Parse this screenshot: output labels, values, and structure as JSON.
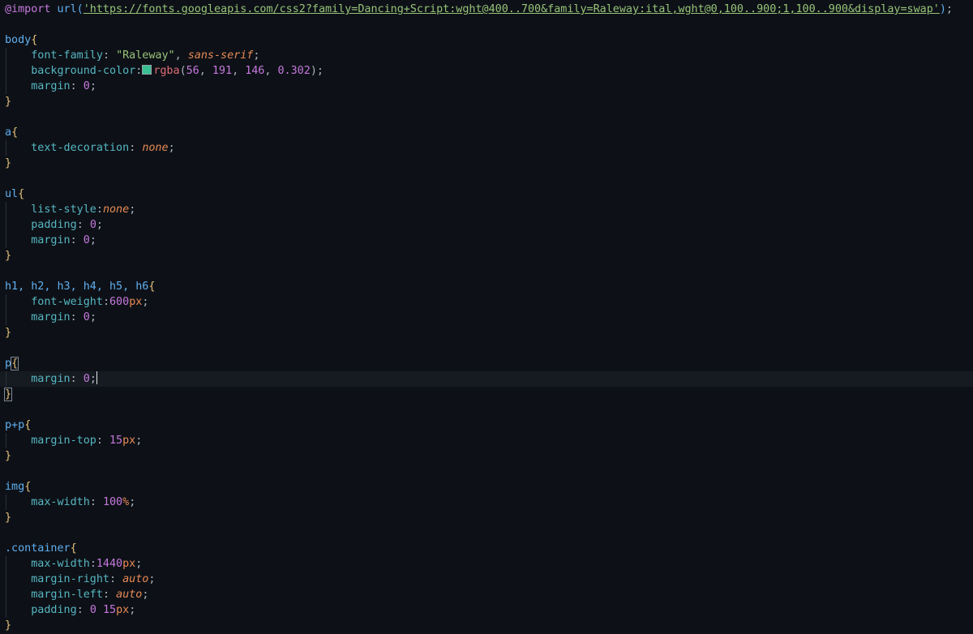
{
  "editor": {
    "language": "css",
    "cursor_line": 24,
    "swatch_color": "#38bf92",
    "lines": [
      {
        "tokens": [
          {
            "t": "@import",
            "c": "atrule"
          },
          {
            "t": " ",
            "c": "punct"
          },
          {
            "t": "url(",
            "c": "func"
          },
          {
            "t": "'https://fonts.googleapis.com/css2?family=Dancing+Script:wght@400..700&family=Raleway:ital,wght@0,100..900;1,100..900&display=swap'",
            "c": "url"
          },
          {
            "t": ")",
            "c": "func"
          },
          {
            "t": ";",
            "c": "semi"
          }
        ]
      },
      {
        "tokens": []
      },
      {
        "tokens": [
          {
            "t": "body",
            "c": "selector"
          },
          {
            "t": "{",
            "c": "brace"
          }
        ]
      },
      {
        "indent": true,
        "tokens": [
          {
            "t": "    font-family",
            "c": "prop"
          },
          {
            "t": ": ",
            "c": "colon"
          },
          {
            "t": "\"Raleway\"",
            "c": "string"
          },
          {
            "t": ", ",
            "c": "punct"
          },
          {
            "t": "sans-serif",
            "c": "keyword"
          },
          {
            "t": ";",
            "c": "semi"
          }
        ]
      },
      {
        "indent": true,
        "tokens": [
          {
            "t": "    background-color",
            "c": "prop"
          },
          {
            "t": ":",
            "c": "colon"
          },
          {
            "swatch": true
          },
          {
            "t": "rgba",
            "c": "fnname"
          },
          {
            "t": "(",
            "c": "punct"
          },
          {
            "t": "56",
            "c": "number"
          },
          {
            "t": ", ",
            "c": "punct"
          },
          {
            "t": "191",
            "c": "number"
          },
          {
            "t": ", ",
            "c": "punct"
          },
          {
            "t": "146",
            "c": "number"
          },
          {
            "t": ", ",
            "c": "punct"
          },
          {
            "t": "0.302",
            "c": "number"
          },
          {
            "t": ")",
            "c": "punct"
          },
          {
            "t": ";",
            "c": "semi"
          }
        ]
      },
      {
        "indent": true,
        "tokens": [
          {
            "t": "    margin",
            "c": "prop"
          },
          {
            "t": ": ",
            "c": "colon"
          },
          {
            "t": "0",
            "c": "number"
          },
          {
            "t": ";",
            "c": "semi"
          }
        ]
      },
      {
        "tokens": [
          {
            "t": "}",
            "c": "brace"
          }
        ]
      },
      {
        "tokens": []
      },
      {
        "tokens": [
          {
            "t": "a",
            "c": "selector"
          },
          {
            "t": "{",
            "c": "brace"
          }
        ]
      },
      {
        "indent": true,
        "tokens": [
          {
            "t": "    text-decoration",
            "c": "prop"
          },
          {
            "t": ": ",
            "c": "colon"
          },
          {
            "t": "none",
            "c": "keyword"
          },
          {
            "t": ";",
            "c": "semi"
          }
        ]
      },
      {
        "tokens": [
          {
            "t": "}",
            "c": "brace"
          }
        ]
      },
      {
        "tokens": []
      },
      {
        "tokens": [
          {
            "t": "ul",
            "c": "selector"
          },
          {
            "t": "{",
            "c": "brace"
          }
        ]
      },
      {
        "indent": true,
        "tokens": [
          {
            "t": "    list-style",
            "c": "prop"
          },
          {
            "t": ":",
            "c": "colon"
          },
          {
            "t": "none",
            "c": "keyword"
          },
          {
            "t": ";",
            "c": "semi"
          }
        ]
      },
      {
        "indent": true,
        "tokens": [
          {
            "t": "    padding",
            "c": "prop"
          },
          {
            "t": ": ",
            "c": "colon"
          },
          {
            "t": "0",
            "c": "number"
          },
          {
            "t": ";",
            "c": "semi"
          }
        ]
      },
      {
        "indent": true,
        "tokens": [
          {
            "t": "    margin",
            "c": "prop"
          },
          {
            "t": ": ",
            "c": "colon"
          },
          {
            "t": "0",
            "c": "number"
          },
          {
            "t": ";",
            "c": "semi"
          }
        ]
      },
      {
        "tokens": [
          {
            "t": "}",
            "c": "brace"
          }
        ]
      },
      {
        "tokens": []
      },
      {
        "tokens": [
          {
            "t": "h1, h2, h3, h4, h5, h6",
            "c": "selector"
          },
          {
            "t": "{",
            "c": "brace"
          }
        ]
      },
      {
        "indent": true,
        "tokens": [
          {
            "t": "    font-weight",
            "c": "prop"
          },
          {
            "t": ":",
            "c": "colon"
          },
          {
            "t": "600",
            "c": "number"
          },
          {
            "t": "px",
            "c": "unit"
          },
          {
            "t": ";",
            "c": "semi"
          }
        ]
      },
      {
        "indent": true,
        "tokens": [
          {
            "t": "    margin",
            "c": "prop"
          },
          {
            "t": ": ",
            "c": "colon"
          },
          {
            "t": "0",
            "c": "number"
          },
          {
            "t": ";",
            "c": "semi"
          }
        ]
      },
      {
        "tokens": [
          {
            "t": "}",
            "c": "brace"
          }
        ]
      },
      {
        "tokens": []
      },
      {
        "tokens": [
          {
            "t": "p",
            "c": "selector"
          },
          {
            "t": "{",
            "c": "brace",
            "match": true
          }
        ]
      },
      {
        "indent": true,
        "active": true,
        "cursor": true,
        "tokens": [
          {
            "t": "    margin",
            "c": "prop"
          },
          {
            "t": ": ",
            "c": "colon"
          },
          {
            "t": "0",
            "c": "number"
          },
          {
            "t": ";",
            "c": "semi"
          }
        ]
      },
      {
        "tokens": [
          {
            "t": "}",
            "c": "brace",
            "match": true
          }
        ]
      },
      {
        "tokens": []
      },
      {
        "tokens": [
          {
            "t": "p+p",
            "c": "selector"
          },
          {
            "t": "{",
            "c": "brace"
          }
        ]
      },
      {
        "indent": true,
        "tokens": [
          {
            "t": "    margin-top",
            "c": "prop"
          },
          {
            "t": ": ",
            "c": "colon"
          },
          {
            "t": "15",
            "c": "number"
          },
          {
            "t": "px",
            "c": "unit"
          },
          {
            "t": ";",
            "c": "semi"
          }
        ]
      },
      {
        "tokens": [
          {
            "t": "}",
            "c": "brace"
          }
        ]
      },
      {
        "tokens": []
      },
      {
        "tokens": [
          {
            "t": "img",
            "c": "selector"
          },
          {
            "t": "{",
            "c": "brace"
          }
        ]
      },
      {
        "indent": true,
        "tokens": [
          {
            "t": "    max-width",
            "c": "prop"
          },
          {
            "t": ": ",
            "c": "colon"
          },
          {
            "t": "100",
            "c": "number"
          },
          {
            "t": "%",
            "c": "unit"
          },
          {
            "t": ";",
            "c": "semi"
          }
        ]
      },
      {
        "tokens": [
          {
            "t": "}",
            "c": "brace"
          }
        ]
      },
      {
        "tokens": []
      },
      {
        "tokens": [
          {
            "t": ".container",
            "c": "selector"
          },
          {
            "t": "{",
            "c": "brace"
          }
        ]
      },
      {
        "indent": true,
        "tokens": [
          {
            "t": "    max-width",
            "c": "prop"
          },
          {
            "t": ":",
            "c": "colon"
          },
          {
            "t": "1440",
            "c": "number"
          },
          {
            "t": "px",
            "c": "unit"
          },
          {
            "t": ";",
            "c": "semi"
          }
        ]
      },
      {
        "indent": true,
        "tokens": [
          {
            "t": "    margin-right",
            "c": "prop"
          },
          {
            "t": ": ",
            "c": "colon"
          },
          {
            "t": "auto",
            "c": "keyword"
          },
          {
            "t": ";",
            "c": "semi"
          }
        ]
      },
      {
        "indent": true,
        "tokens": [
          {
            "t": "    margin-left",
            "c": "prop"
          },
          {
            "t": ": ",
            "c": "colon"
          },
          {
            "t": "auto",
            "c": "keyword"
          },
          {
            "t": ";",
            "c": "semi"
          }
        ]
      },
      {
        "indent": true,
        "tokens": [
          {
            "t": "    padding",
            "c": "prop"
          },
          {
            "t": ": ",
            "c": "colon"
          },
          {
            "t": "0",
            "c": "number"
          },
          {
            "t": " ",
            "c": "punct"
          },
          {
            "t": "15",
            "c": "number"
          },
          {
            "t": "px",
            "c": "unit"
          },
          {
            "t": ";",
            "c": "semi"
          }
        ]
      },
      {
        "tokens": [
          {
            "t": "}",
            "c": "brace"
          }
        ]
      }
    ]
  }
}
